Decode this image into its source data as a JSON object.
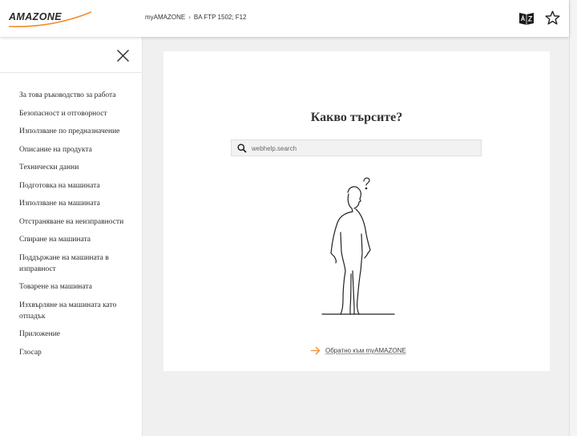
{
  "header": {
    "logo_text": "AMAZONE",
    "breadcrumb": [
      "myAMAZONE",
      "BA FTP 1502; F12"
    ],
    "breadcrumb_separator": "›",
    "icons": [
      "language-dictionary-icon",
      "star-icon"
    ]
  },
  "sidebar": {
    "close_icon": "close-icon",
    "items": [
      {
        "label": "За това ръководство за работа"
      },
      {
        "label": "Безопасност и отговорност"
      },
      {
        "label": "Използване по предназначение"
      },
      {
        "label": "Описание на продукта"
      },
      {
        "label": "Технически данни"
      },
      {
        "label": "Подготовка на машината"
      },
      {
        "label": "Използване на машината"
      },
      {
        "label": "Отстраняване на неизправности"
      },
      {
        "label": "Спиране на машината"
      },
      {
        "label": "Поддържане на машината в изправност"
      },
      {
        "label": "Товарене на машината"
      },
      {
        "label": "Изхвърляне на машината като отпадък"
      },
      {
        "label": "Приложение"
      },
      {
        "label": "Глосар"
      }
    ]
  },
  "main": {
    "title": "Какво търсите?",
    "search": {
      "placeholder": "webhelp.search",
      "value": ""
    },
    "back_link": "Обратно към myAMAZONE"
  },
  "colors": {
    "accent": "#f28c28",
    "background": "#f0f0f0",
    "card": "#ffffff",
    "text": "#333333"
  }
}
